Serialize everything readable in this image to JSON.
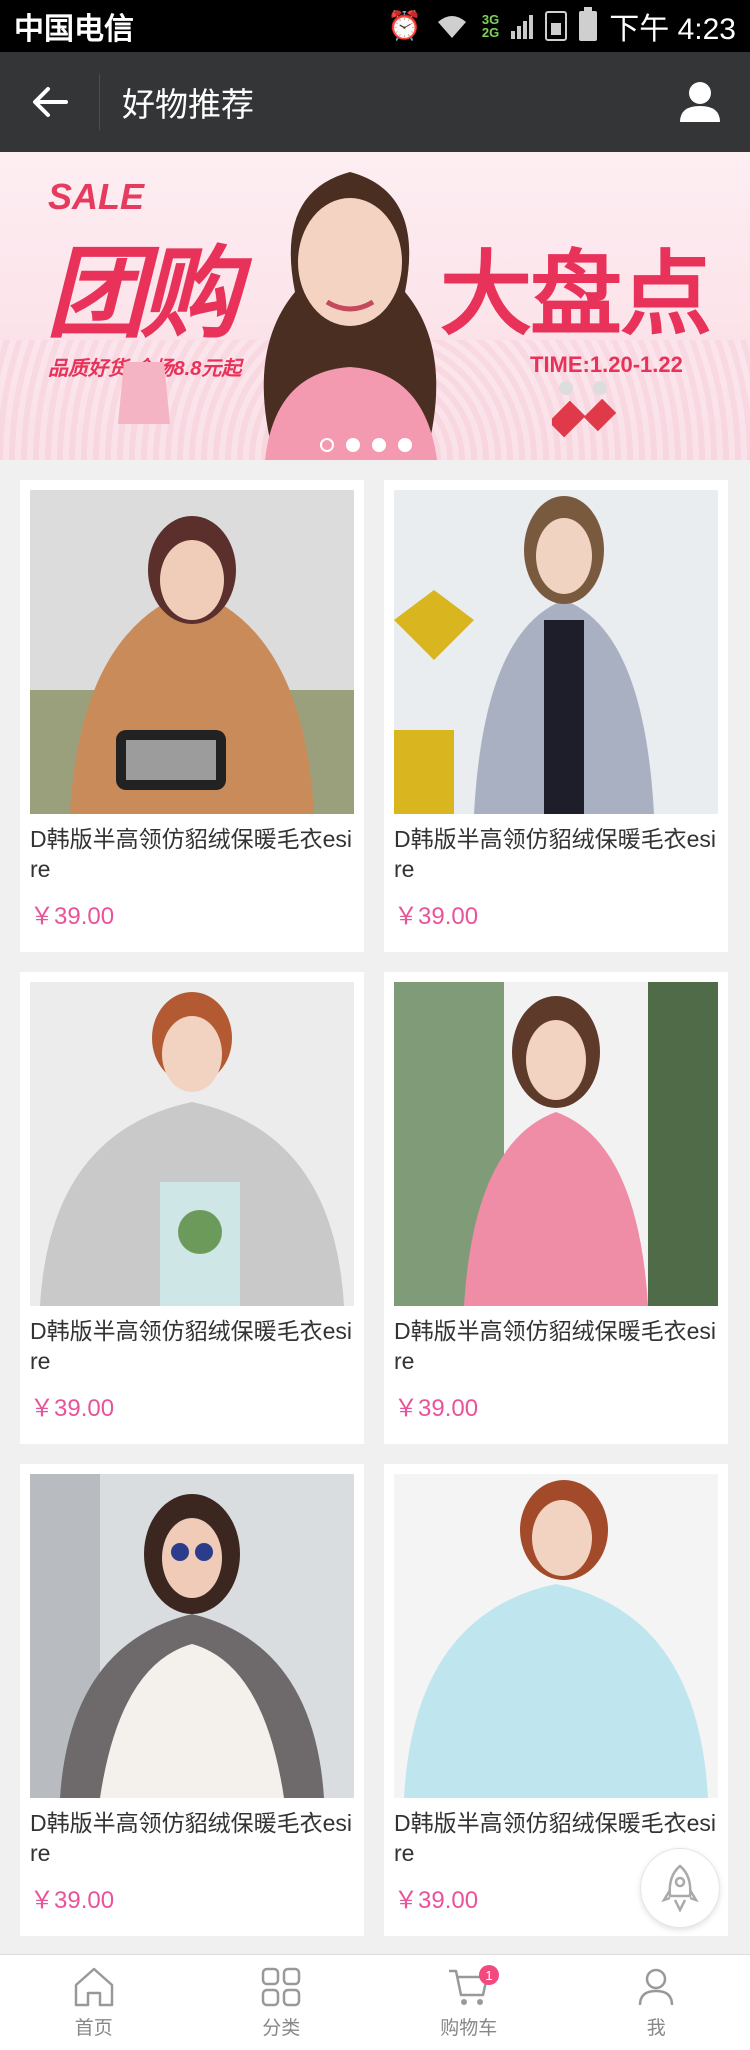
{
  "status_bar": {
    "carrier": "中国电信",
    "network": "3G 2G",
    "time": "下午 4:23"
  },
  "header": {
    "title": "好物推荐"
  },
  "banner": {
    "sale": "SALE",
    "headline_left": "团购",
    "headline_right": "大盘点",
    "subtitle": "品质好货 全场8.8元起",
    "time_range": "TIME:1.20-1.22",
    "slides": 4,
    "active_slide": 0
  },
  "products": [
    {
      "name": "D韩版半高领仿貂绒保暖毛衣esire",
      "price": "￥39.00"
    },
    {
      "name": "D韩版半高领仿貂绒保暖毛衣esire",
      "price": "￥39.00"
    },
    {
      "name": "D韩版半高领仿貂绒保暖毛衣esire",
      "price": "￥39.00"
    },
    {
      "name": "D韩版半高领仿貂绒保暖毛衣esire",
      "price": "￥39.00"
    },
    {
      "name": "D韩版半高领仿貂绒保暖毛衣esire",
      "price": "￥39.00"
    },
    {
      "name": "D韩版半高领仿貂绒保暖毛衣esire",
      "price": "￥39.00"
    }
  ],
  "tabbar": {
    "items": [
      {
        "label": "首页",
        "icon": "home-icon"
      },
      {
        "label": "分类",
        "icon": "grid-icon"
      },
      {
        "label": "购物车",
        "icon": "cart-icon",
        "badge": "1"
      },
      {
        "label": "我",
        "icon": "user-icon"
      }
    ]
  },
  "colors": {
    "accent": "#e8539a",
    "header_bg": "#333537",
    "banner_red": "#e8325a"
  }
}
